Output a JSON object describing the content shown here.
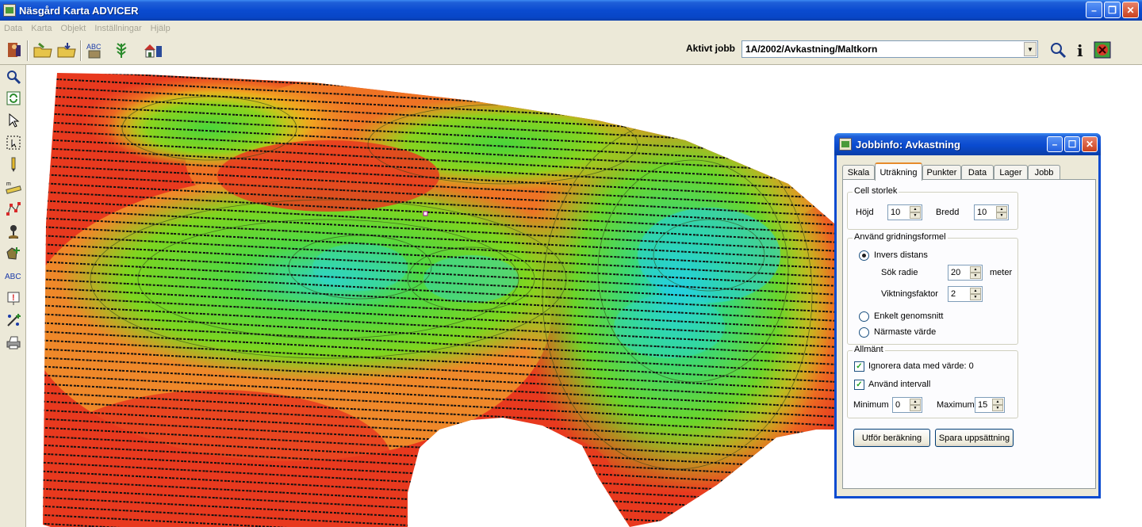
{
  "app": {
    "title": "Näsgård Karta ADVICER"
  },
  "menu": [
    "Data",
    "Karta",
    "Objekt",
    "Inställningar",
    "Hjälp"
  ],
  "toolbar": {
    "active_job_label": "Aktivt jobb",
    "active_job_value": "1A/2002/Avkastning/Maltkorn"
  },
  "colors": {
    "xp_blue": "#0a4bd0",
    "face": "#ece9d8",
    "map_red": "#e8391e",
    "map_green": "#5fd12a",
    "map_cyan": "#22d3d4"
  },
  "dialog": {
    "title": "Jobbinfo: Avkastning",
    "tabs": [
      "Skala",
      "Uträkning",
      "Punkter",
      "Data",
      "Lager",
      "Jobb"
    ],
    "active_tab": "Uträkning",
    "cell": {
      "group": "Cell storlek",
      "height_label": "Höjd",
      "height_value": "10",
      "width_label": "Bredd",
      "width_value": "10"
    },
    "formula": {
      "group": "Använd gridningsformel",
      "inverse": "Invers distans",
      "search_radius_label": "Sök radie",
      "search_radius_value": "20",
      "search_radius_unit": "meter",
      "weight_label": "Viktningsfaktor",
      "weight_value": "2",
      "simple_avg": "Enkelt genomsnitt",
      "nearest": "Närmaste värde"
    },
    "general": {
      "group": "Allmänt",
      "ignore_zero": "Ignorera data med värde: 0",
      "use_interval": "Använd intervall",
      "min_label": "Minimum",
      "min_value": "0",
      "max_label": "Maximum",
      "max_value": "15"
    },
    "buttons": {
      "calculate": "Utför beräkning",
      "save": "Spara uppsättning"
    }
  }
}
